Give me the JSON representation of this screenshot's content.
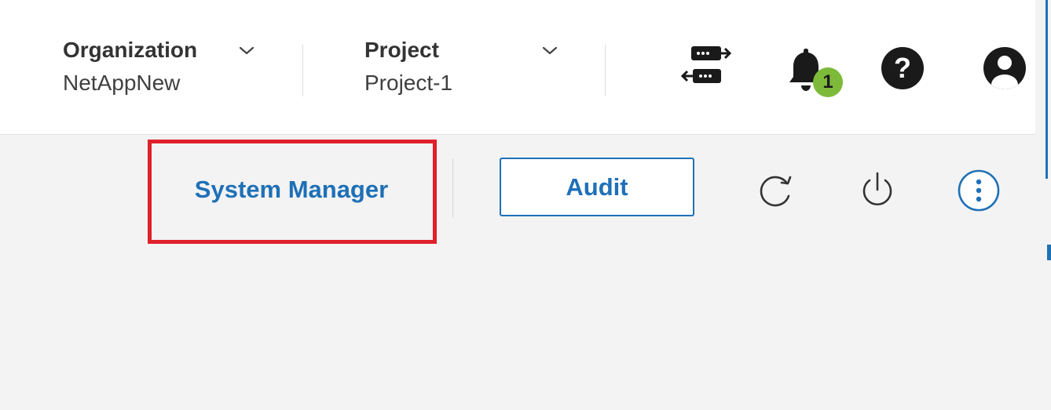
{
  "header": {
    "organization": {
      "title": "Organization",
      "value": "NetAppNew"
    },
    "project": {
      "title": "Project",
      "value": "Project-1"
    },
    "notifications": {
      "count": "1"
    },
    "icons": [
      "connector-icon",
      "bell-icon",
      "help-icon",
      "user-icon"
    ]
  },
  "toolbar": {
    "system_manager_label": "System Manager",
    "audit_label": "Audit",
    "icons": [
      "refresh-icon",
      "power-icon",
      "more-options-icon"
    ]
  },
  "colors": {
    "accent": "#1e70b7",
    "highlight": "#e0202a",
    "badge": "#7dba3a"
  }
}
